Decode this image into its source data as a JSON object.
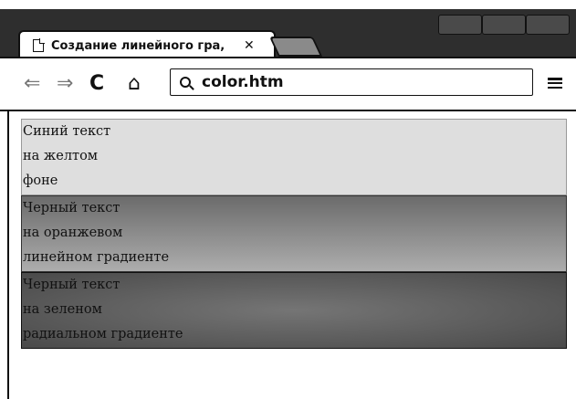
{
  "tab": {
    "title": "Создание линейного гра,",
    "close": "✕"
  },
  "toolbar": {
    "back": "⇐",
    "forward": "⇒",
    "reload": "C",
    "home": "⌂",
    "url": "color.htm"
  },
  "blocks": [
    {
      "lines": [
        "Синий текст",
        "на желтом",
        "фоне"
      ]
    },
    {
      "lines": [
        "Черный текст",
        "на оранжевом",
        "линейном градиенте"
      ]
    },
    {
      "lines": [
        "Черный текст",
        "на зеленом",
        "радиальном градиенте"
      ]
    }
  ]
}
